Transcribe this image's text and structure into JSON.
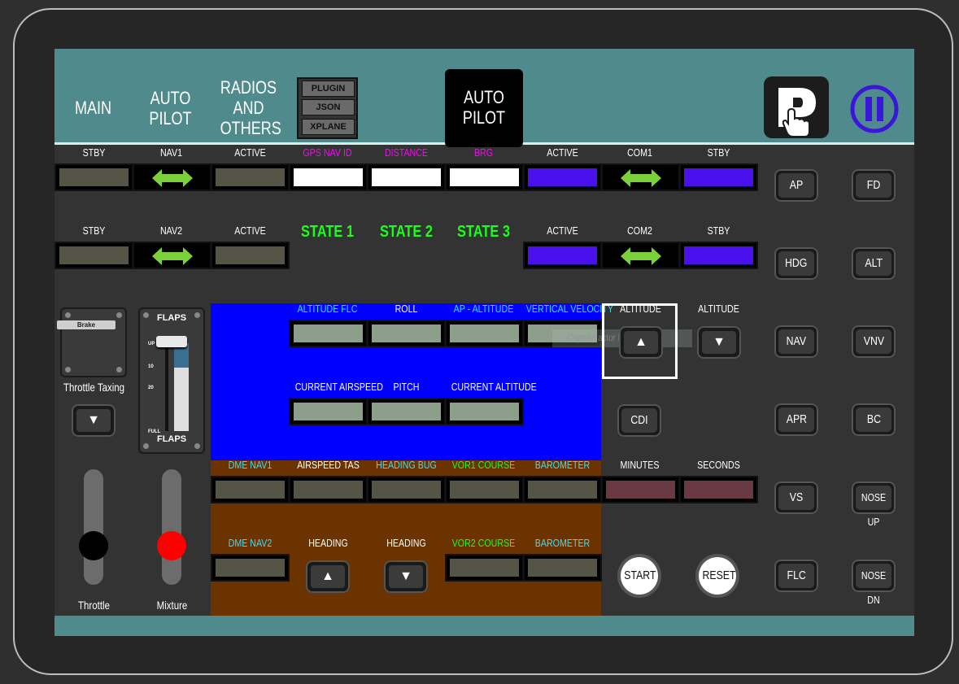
{
  "nav": {
    "main": "MAIN",
    "autopilot_1": "AUTO",
    "autopilot_2": "PILOT",
    "radios_1": "RADIOS",
    "radios_2": "AND",
    "radios_3": "OTHERS",
    "active_1": "AUTO",
    "active_2": "PILOT",
    "plugin": "PLUGIN",
    "json": "JSON",
    "xplane": "XPLANE"
  },
  "row1": {
    "stby_left": "STBY",
    "nav1": "NAV1",
    "active_left": "ACTIVE",
    "gps_nav_id": "GPS NAV ID",
    "distance": "DISTANCE",
    "brg": "BRG",
    "active_right": "ACTIVE",
    "com1": "COM1",
    "stby_right": "STBY"
  },
  "row2": {
    "stby_left": "STBY",
    "nav2": "NAV2",
    "active_left": "ACTIVE",
    "state1": "STATE 1",
    "state2": "STATE 2",
    "state3": "STATE 3",
    "active_right": "ACTIVE",
    "com2": "COM2",
    "stby_right": "STBY"
  },
  "autopilot_panel": {
    "altitude_flc": "ALTITUDE FLC",
    "roll": "ROLL",
    "ap_altitude": "AP - ALTITUDE",
    "vertical_velocity": "VERTICAL VELOCITY",
    "current_airspeed": "CURRENT AIRSPEED",
    "pitch": "PITCH",
    "current_altitude": "CURRENT ALTITUDE",
    "altitude_up": "ALTITUDE",
    "altitude_down": "ALTITUDE",
    "capture_overlay": "Capture actor bg"
  },
  "left_panel": {
    "brake_label": "Brake",
    "throttle_taxing": "Throttle Taxing",
    "flaps_top": "FLAPS",
    "flaps_bottom": "FLAPS",
    "flaps_up": "UP",
    "flaps_10": "10",
    "flaps_20": "20",
    "flaps_full": "FULL",
    "throttle": "Throttle",
    "mixture": "Mixture"
  },
  "lower_rows": {
    "dme_nav1": "DME NAV1",
    "airspeed_tas": "AIRSPEED TAS",
    "heading_bug": "HEADING BUG",
    "vor1_course": "VOR1 COURSE",
    "barometer_1": "BAROMETER",
    "minutes": "MINUTES",
    "seconds": "SECONDS",
    "dme_nav2": "DME NAV2",
    "heading_up": "HEADING",
    "heading_down": "HEADING",
    "vor2_course": "VOR2 COURSE",
    "barometer_2": "BAROMETER",
    "cdi": "CDI",
    "start": "START",
    "reset": "RESET"
  },
  "ap_buttons": {
    "ap": "AP",
    "fd": "FD",
    "hdg": "HDG",
    "alt": "ALT",
    "nav": "NAV",
    "vnv": "VNV",
    "apr": "APR",
    "bc": "BC",
    "vs": "VS",
    "nose_up": "NOSE UP",
    "flc": "FLC",
    "nose_dn": "NOSE DN"
  },
  "colors": {
    "teal_bar": "#4f8b8c",
    "blue_panel": "#0000ff",
    "brown_panel": "#6b3300",
    "stby_display": "#545447",
    "com_display": "#4a10ee",
    "gps_display": "#ffffff",
    "green_display": "#8d9e8b",
    "timer_display": "#6a3a44",
    "magenta_text": "#ff00ff",
    "cyan_text": "#33e0ff",
    "green_text": "#1aff1a",
    "mixture_knob": "#ff0000"
  }
}
